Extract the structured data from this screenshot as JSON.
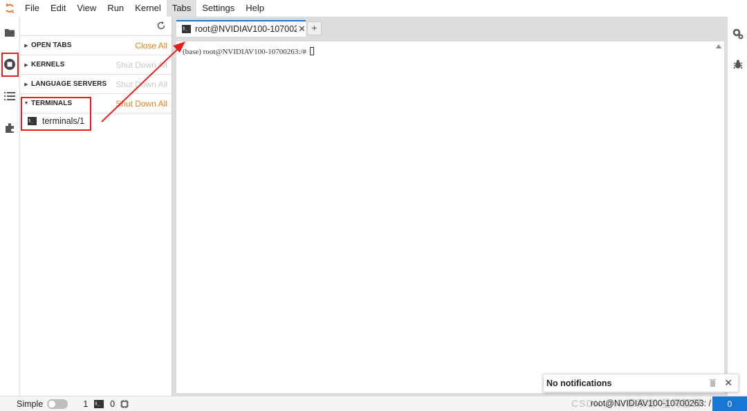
{
  "menu": {
    "items": [
      {
        "label": "File"
      },
      {
        "label": "Edit"
      },
      {
        "label": "View"
      },
      {
        "label": "Run"
      },
      {
        "label": "Kernel"
      },
      {
        "label": "Tabs"
      },
      {
        "label": "Settings"
      },
      {
        "label": "Help"
      }
    ]
  },
  "activity_bar": {
    "icons": [
      "folder-icon",
      "running-sessions-icon",
      "table-of-contents-icon",
      "extensions-icon"
    ],
    "right_icons": [
      "property-inspector-gears-icon",
      "debugger-bug-icon"
    ]
  },
  "running_panel": {
    "sections": [
      {
        "title": "OPEN TABS",
        "action": "Close All",
        "expanded": false,
        "action_enabled": true
      },
      {
        "title": "KERNELS",
        "action": "Shut Down All",
        "expanded": false,
        "action_enabled": false
      },
      {
        "title": "LANGUAGE SERVERS",
        "action": "Shut Down All",
        "expanded": false,
        "action_enabled": false
      },
      {
        "title": "TERMINALS",
        "action": "Shut Down All",
        "expanded": true,
        "action_enabled": true
      }
    ],
    "terminal_items": [
      {
        "label": "terminals/1",
        "icon_text": "$_"
      }
    ]
  },
  "tabs": {
    "active_label": "root@NVIDIAV100-107002",
    "icon_text": "$_",
    "new_tab_label": "+"
  },
  "terminal": {
    "line": "(base) root@NVIDIAV100-10700263:/# "
  },
  "status_bar": {
    "mode_label": "Simple",
    "terminal_count": "1",
    "terminal_icon_text": "$_",
    "kernel_count": "0",
    "right_text": "root@NVIDIAV100-10700263: /",
    "badge_text": "0"
  },
  "notification": {
    "title": "No notifications"
  },
  "watermark": "CSDN @AI探索者-星海智算",
  "colors": {
    "accent": "#1976d2",
    "action_orange": "#e2801c",
    "annotation_red": "#e02020"
  }
}
